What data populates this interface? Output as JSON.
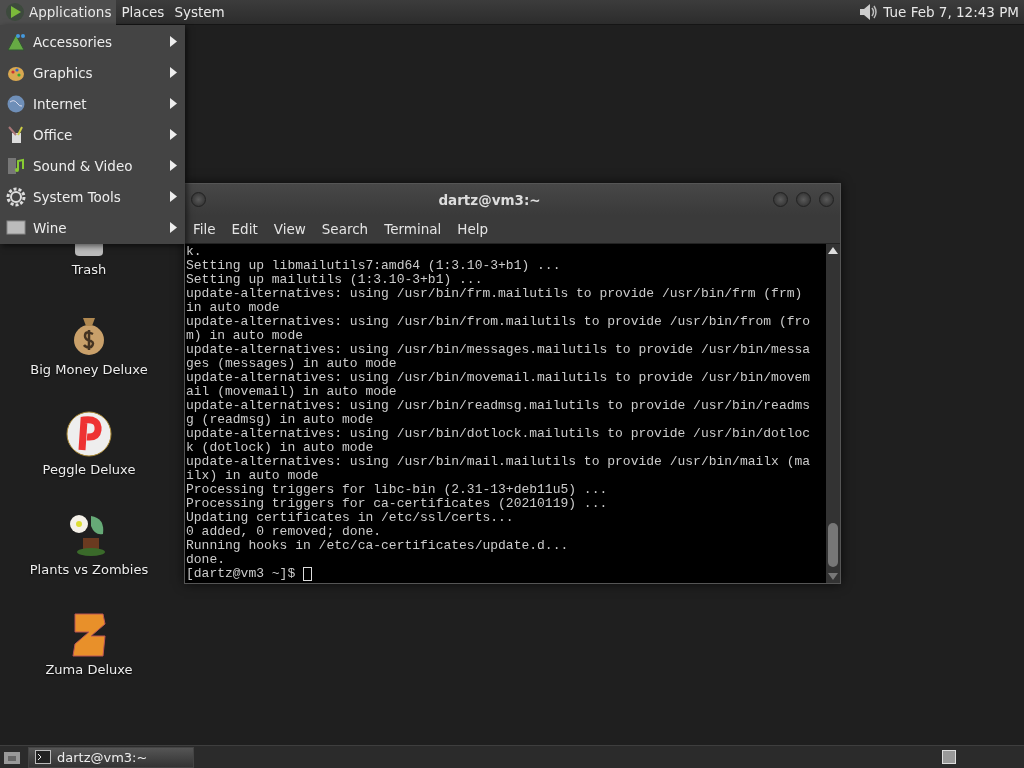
{
  "top_panel": {
    "menus": [
      {
        "label": "Applications",
        "selected": true
      },
      {
        "label": "Places",
        "selected": false
      },
      {
        "label": "System",
        "selected": false
      }
    ],
    "clock": "Tue Feb  7, 12:43 PM"
  },
  "applications_menu": {
    "items": [
      {
        "label": "Accessories",
        "kind": "accessories"
      },
      {
        "label": "Graphics",
        "kind": "graphics"
      },
      {
        "label": "Internet",
        "kind": "internet"
      },
      {
        "label": "Office",
        "kind": "office"
      },
      {
        "label": "Sound & Video",
        "kind": "sound"
      },
      {
        "label": "System Tools",
        "kind": "tools"
      },
      {
        "label": "Wine",
        "kind": "wine"
      }
    ]
  },
  "desktop_icons": [
    {
      "label": "Trash",
      "kind": "trash"
    },
    {
      "label": "Big Money Deluxe",
      "kind": "money"
    },
    {
      "label": "Peggle Deluxe",
      "kind": "peggle"
    },
    {
      "label": "Plants vs Zombies",
      "kind": "plants"
    },
    {
      "label": "Zuma Deluxe",
      "kind": "zuma"
    }
  ],
  "terminal": {
    "title": "dartz@vm3:~",
    "menu": [
      "File",
      "Edit",
      "View",
      "Search",
      "Terminal",
      "Help"
    ],
    "lines": [
      "k.",
      "Setting up libmailutils7:amd64 (1:3.10-3+b1) ...",
      "Setting up mailutils (1:3.10-3+b1) ...",
      "update-alternatives: using /usr/bin/frm.mailutils to provide /usr/bin/frm (frm)",
      "in auto mode",
      "update-alternatives: using /usr/bin/from.mailutils to provide /usr/bin/from (fro",
      "m) in auto mode",
      "update-alternatives: using /usr/bin/messages.mailutils to provide /usr/bin/messa",
      "ges (messages) in auto mode",
      "update-alternatives: using /usr/bin/movemail.mailutils to provide /usr/bin/movem",
      "ail (movemail) in auto mode",
      "update-alternatives: using /usr/bin/readmsg.mailutils to provide /usr/bin/readms",
      "g (readmsg) in auto mode",
      "update-alternatives: using /usr/bin/dotlock.mailutils to provide /usr/bin/dotloc",
      "k (dotlock) in auto mode",
      "update-alternatives: using /usr/bin/mail.mailutils to provide /usr/bin/mailx (ma",
      "ilx) in auto mode",
      "Processing triggers for libc-bin (2.31-13+deb11u5) ...",
      "Processing triggers for ca-certificates (20210119) ...",
      "Updating certificates in /etc/ssl/certs...",
      "0 added, 0 removed; done.",
      "Running hooks in /etc/ca-certificates/update.d...",
      "done."
    ],
    "prompt": "[dartz@vm3 ~]$ "
  },
  "taskbar": {
    "tasks": [
      {
        "label": "dartz@vm3:~",
        "selected": true
      }
    ]
  }
}
